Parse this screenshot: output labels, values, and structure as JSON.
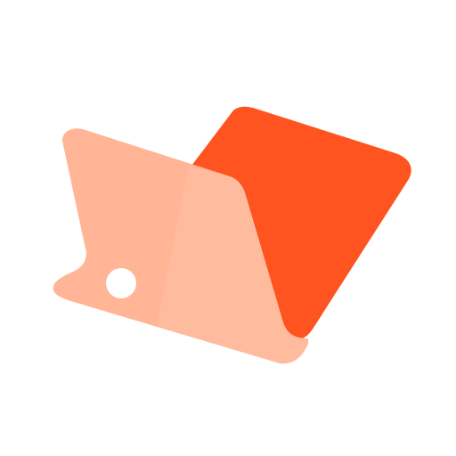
{
  "logo": {
    "name": "folder-logo",
    "colors": {
      "background": "#ffffff",
      "back_panel": "#FF5320",
      "front_panel": "#FFB596",
      "front_panel_highlight": "#FFC3A8",
      "hole": "#ffffff"
    }
  }
}
